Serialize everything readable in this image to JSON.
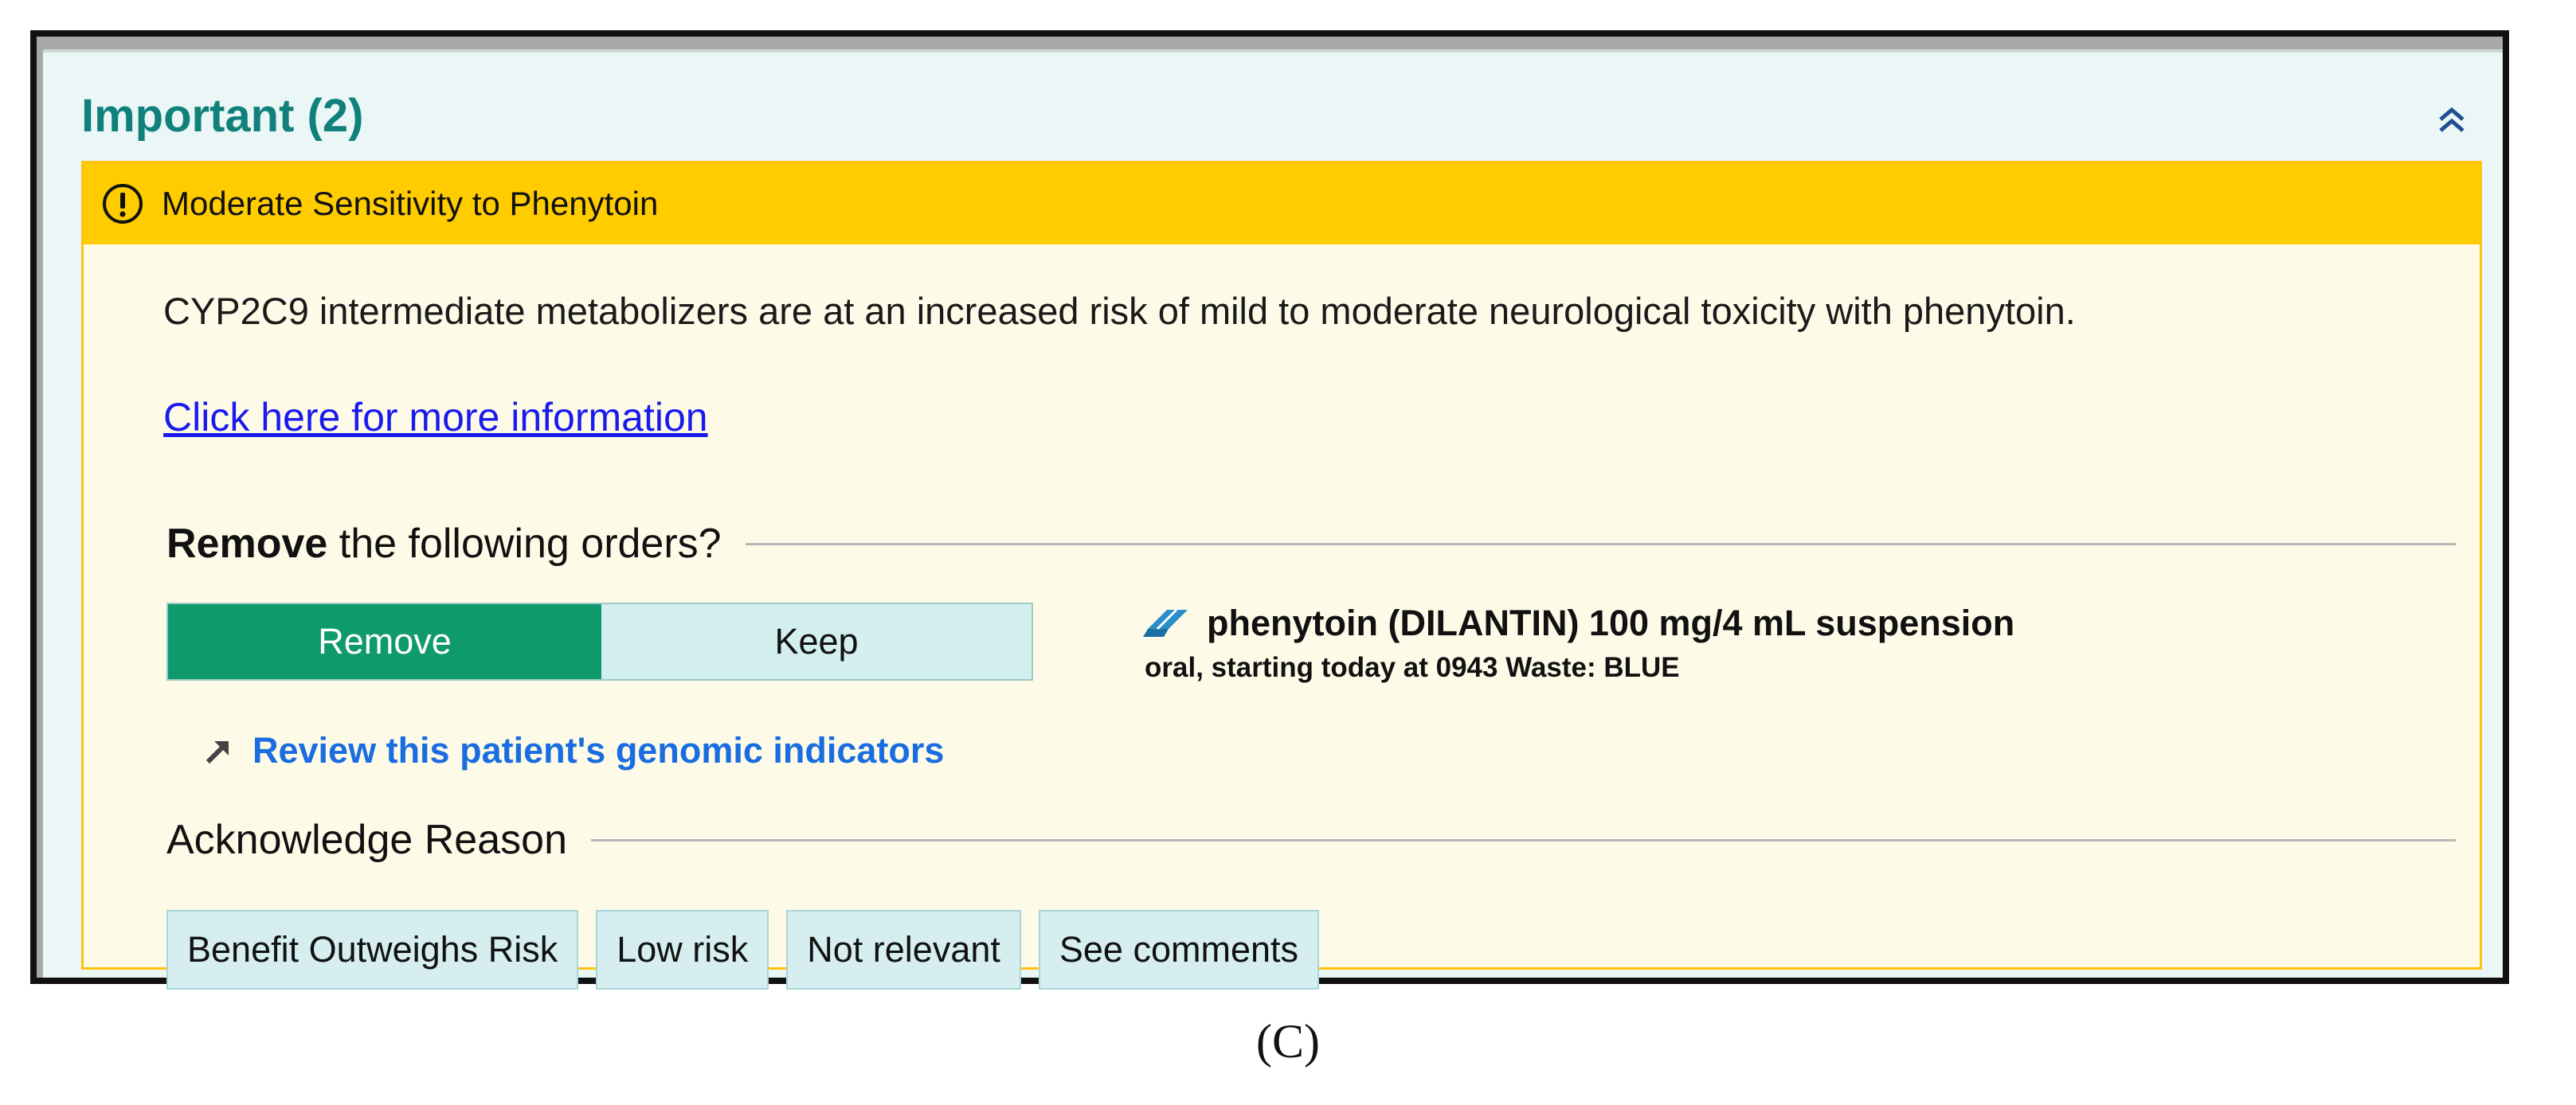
{
  "panel": {
    "title": "Important (2)"
  },
  "alert": {
    "title": "Moderate Sensitivity to Phenytoin",
    "description": "CYP2C9 intermediate metabolizers are at an increased risk of mild to moderate neurological toxicity with phenytoin.",
    "more_info_link": "Click here for more information"
  },
  "remove_section": {
    "label_bold": "Remove",
    "label_rest": " the following orders?",
    "remove_label": "Remove",
    "keep_label": "Keep",
    "selected": "Remove"
  },
  "order": {
    "name": "phenytoin (DILANTIN) 100 mg/4 mL suspension",
    "details": "oral, starting today at 0943 Waste: BLUE"
  },
  "review_link": "Review this patient's genomic indicators",
  "acknowledge": {
    "label": "Acknowledge Reason",
    "reasons": [
      "Benefit Outweighs Risk",
      "Low risk",
      "Not relevant",
      "See comments"
    ]
  },
  "caption": "(C)",
  "colors": {
    "panel_title": "#10807a",
    "alert_header": "#ffcc00",
    "remove_selected": "#0f9a6c",
    "link": "#1a1aee",
    "review_link": "#1a6de0"
  },
  "icons": {
    "collapse": "double-chevron-up-icon",
    "warning": "exclamation-circle-icon",
    "medication": "pill-icon",
    "review": "arrow-up-right-icon"
  }
}
